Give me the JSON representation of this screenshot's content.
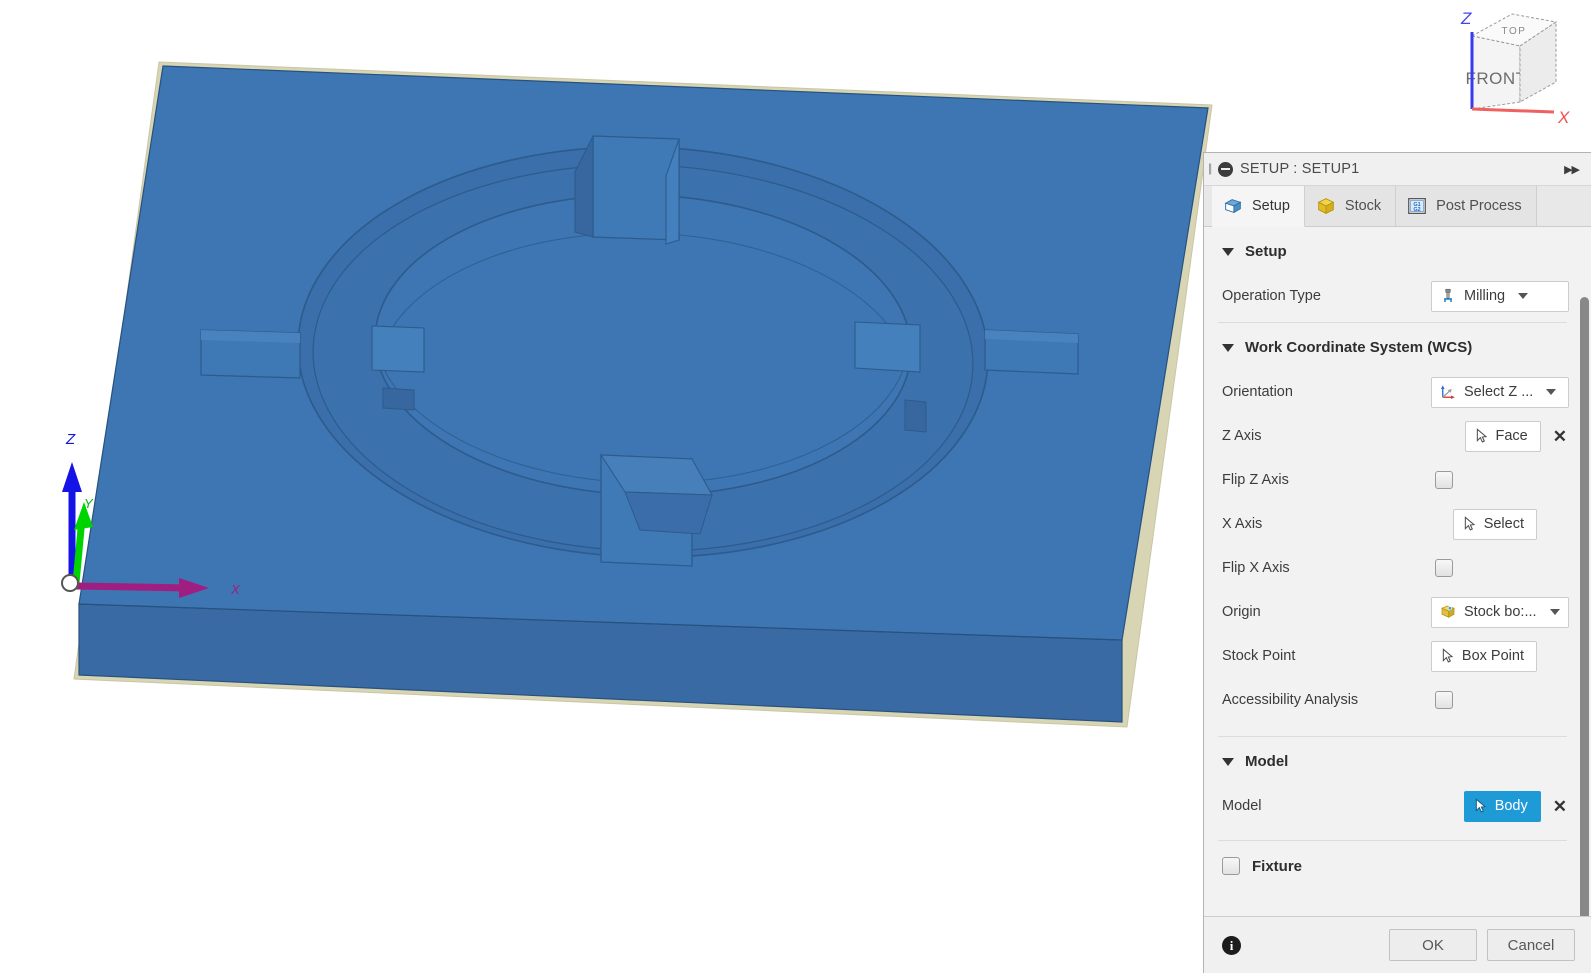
{
  "viewcube": {
    "top_label": "TOP",
    "front_label": "FRONT",
    "z_label": "Z",
    "x_label": "X"
  },
  "viewport": {
    "triad": {
      "z_label": "Z",
      "y_label": "Y",
      "x_label": "X"
    },
    "colors": {
      "body_top": "#3d76b2",
      "body_front": "#3a6fa8",
      "stock_outline": "#d8d5b4",
      "edge": "#27517e",
      "z_axis": "#1414e6",
      "y_axis": "#00d400",
      "x_axis": "#a01d82"
    }
  },
  "panel": {
    "header": {
      "title": "SETUP : SETUP1",
      "expand_icon": "▶▶"
    },
    "tabs": [
      {
        "label": "Setup",
        "icon": "setup-box-icon",
        "active": true
      },
      {
        "label": "Stock",
        "icon": "stock-box-icon",
        "active": false
      },
      {
        "label": "Post Process",
        "icon": "g-code-icon",
        "active": false
      }
    ],
    "sections": {
      "setup": {
        "title": "Setup",
        "operation_type": {
          "label": "Operation Type",
          "value": "Milling"
        }
      },
      "wcs": {
        "title": "Work Coordinate System (WCS)",
        "orientation": {
          "label": "Orientation",
          "value": "Select Z ..."
        },
        "z_axis": {
          "label": "Z Axis",
          "value": "Face",
          "clear": "✕"
        },
        "flip_z_axis": {
          "label": "Flip Z Axis",
          "checked": false
        },
        "x_axis": {
          "label": "X Axis",
          "value": "Select"
        },
        "flip_x_axis": {
          "label": "Flip X Axis",
          "checked": false
        },
        "origin": {
          "label": "Origin",
          "value": "Stock bo:..."
        },
        "stock_point": {
          "label": "Stock Point",
          "value": "Box Point"
        },
        "accessibility_analysis": {
          "label": "Accessibility Analysis",
          "checked": false
        }
      },
      "model": {
        "title": "Model",
        "model_row": {
          "label": "Model",
          "value": "Body",
          "clear": "✕",
          "selected": true
        }
      },
      "fixture": {
        "title": "Fixture",
        "checked": false
      }
    },
    "footer": {
      "info_icon": "i",
      "ok_label": "OK",
      "cancel_label": "Cancel"
    }
  }
}
